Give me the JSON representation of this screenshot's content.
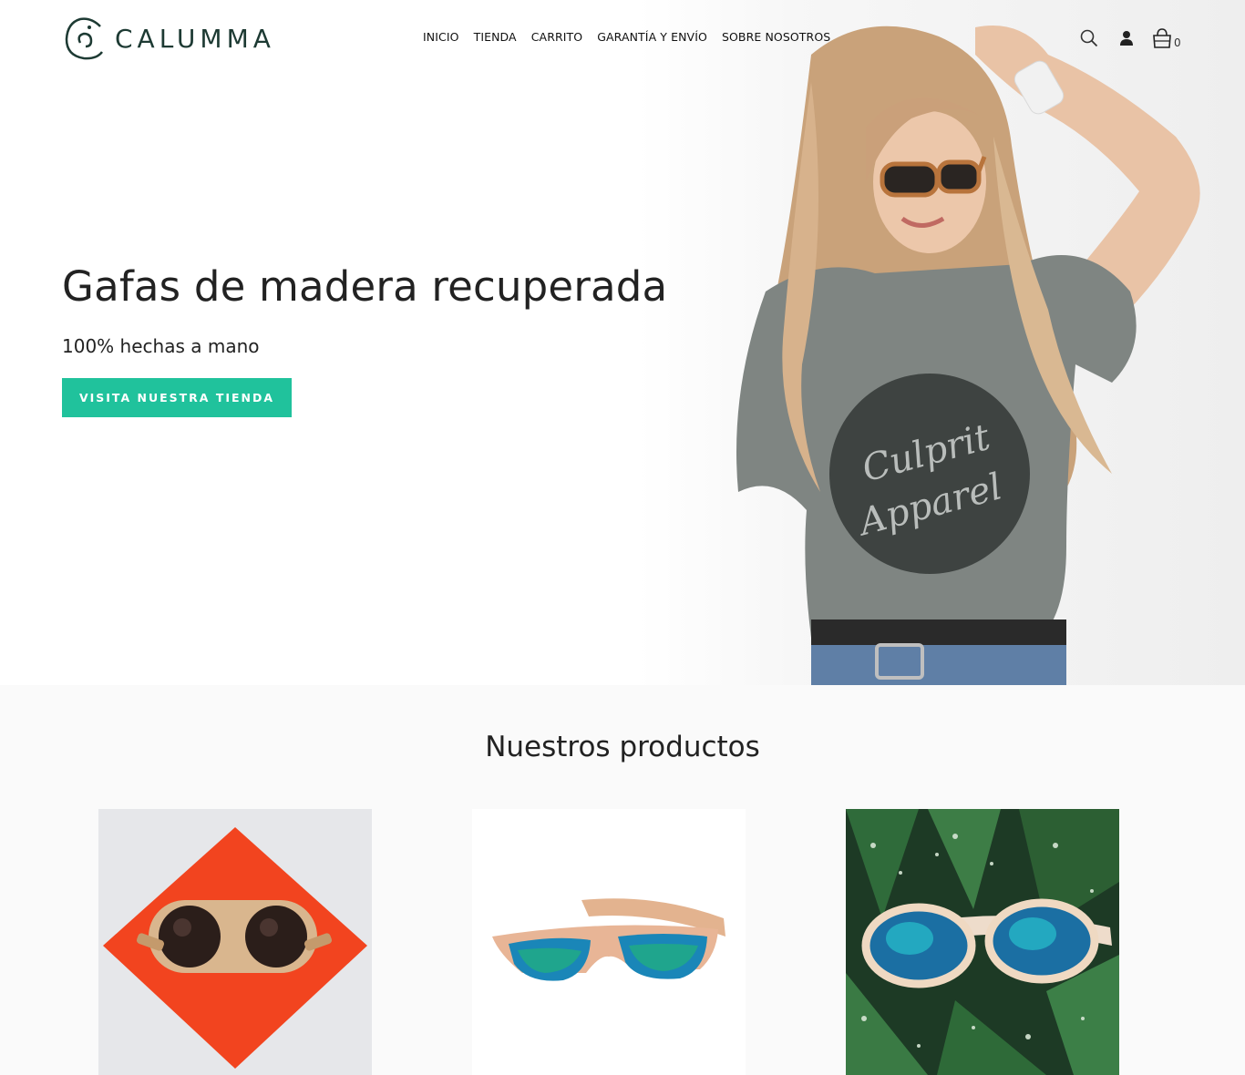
{
  "brand": {
    "name": "CALUMMA",
    "color": "#1d3a33"
  },
  "nav": {
    "items": [
      {
        "label": "INICIO"
      },
      {
        "label": "TIENDA"
      },
      {
        "label": "CARRITO"
      },
      {
        "label": "GARANTÍA Y ENVÍO"
      },
      {
        "label": "SOBRE NOSOTROS"
      }
    ]
  },
  "header_icons": {
    "search": "search-icon",
    "account": "user-icon",
    "cart": "shopping-bag-icon",
    "cart_count": "0"
  },
  "hero": {
    "title": "Gafas de madera recuperada",
    "subtitle": "100% hechas a mano",
    "cta_label": "VISITA NUESTRA TIENDA",
    "cta_color": "#20c29c",
    "shirt_text_line1": "Culprit",
    "shirt_text_line2": "Apparel"
  },
  "products": {
    "title": "Nuestros productos"
  }
}
